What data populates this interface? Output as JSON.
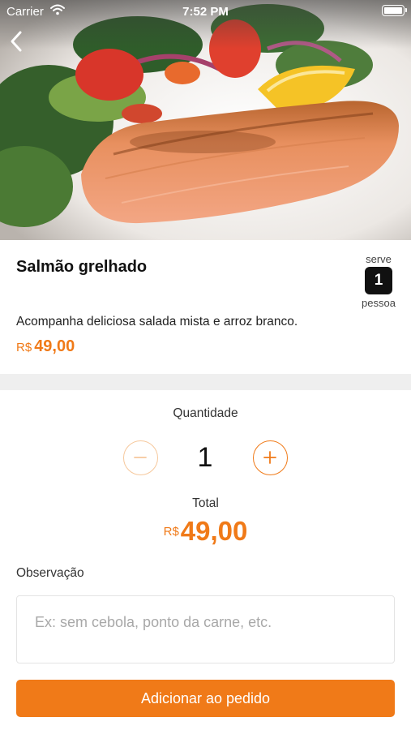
{
  "status_bar": {
    "carrier": "Carrier",
    "time": "7:52 PM",
    "wifi_icon": "wifi-icon",
    "battery_icon": "battery-icon"
  },
  "header": {
    "back_icon": "chevron-left-icon"
  },
  "hero_image": {
    "subject": "grilled-salmon-with-salad-photo"
  },
  "product": {
    "title": "Salmão grelhado",
    "description": "Acompanha deliciosa salada mista e arroz branco.",
    "price_currency": "R$",
    "price_value": "49,00",
    "serves": {
      "label": "serve",
      "count": "1",
      "unit": "pessoa"
    }
  },
  "quantity": {
    "label": "Quantidade",
    "value": "1",
    "minus_icon": "minus-icon",
    "plus_icon": "plus-icon"
  },
  "total": {
    "label": "Total",
    "currency": "R$",
    "value": "49,00"
  },
  "observation": {
    "label": "Observação",
    "placeholder": "Ex: sem cebola, ponto da carne, etc."
  },
  "add_button": {
    "label": "Adicionar ao pedido"
  },
  "colors": {
    "accent": "#f07a18",
    "accent_light": "#f6c89c",
    "divider": "#efefef"
  }
}
